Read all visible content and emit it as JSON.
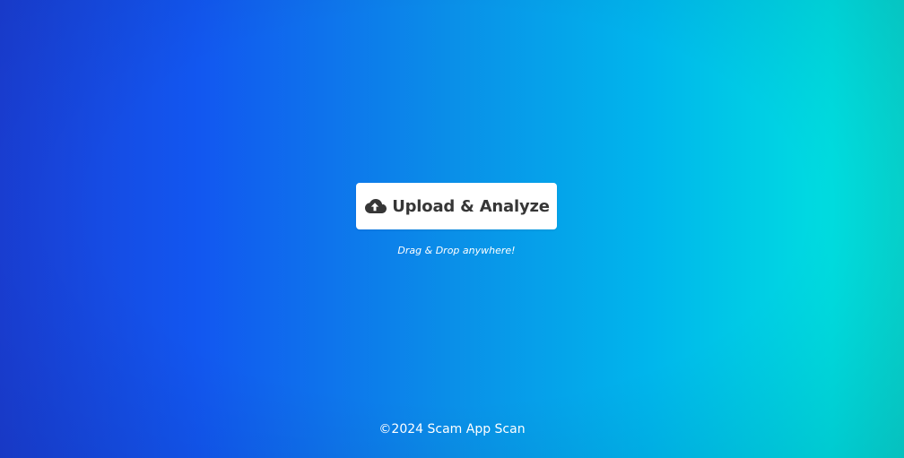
{
  "colors": {
    "gradient_start": "#1a3fd6",
    "gradient_mid": "#0a8fe8",
    "gradient_end": "#00dde0",
    "button_bg": "#ffffff",
    "button_text": "#363636",
    "text_on_bg": "#ffffff"
  },
  "upload": {
    "icon": "cloud-upload-icon",
    "label": "Upload & Analyze",
    "hint": "Drag & Drop anywhere!"
  },
  "footer": {
    "text": "©2024 Scam App Scan"
  }
}
